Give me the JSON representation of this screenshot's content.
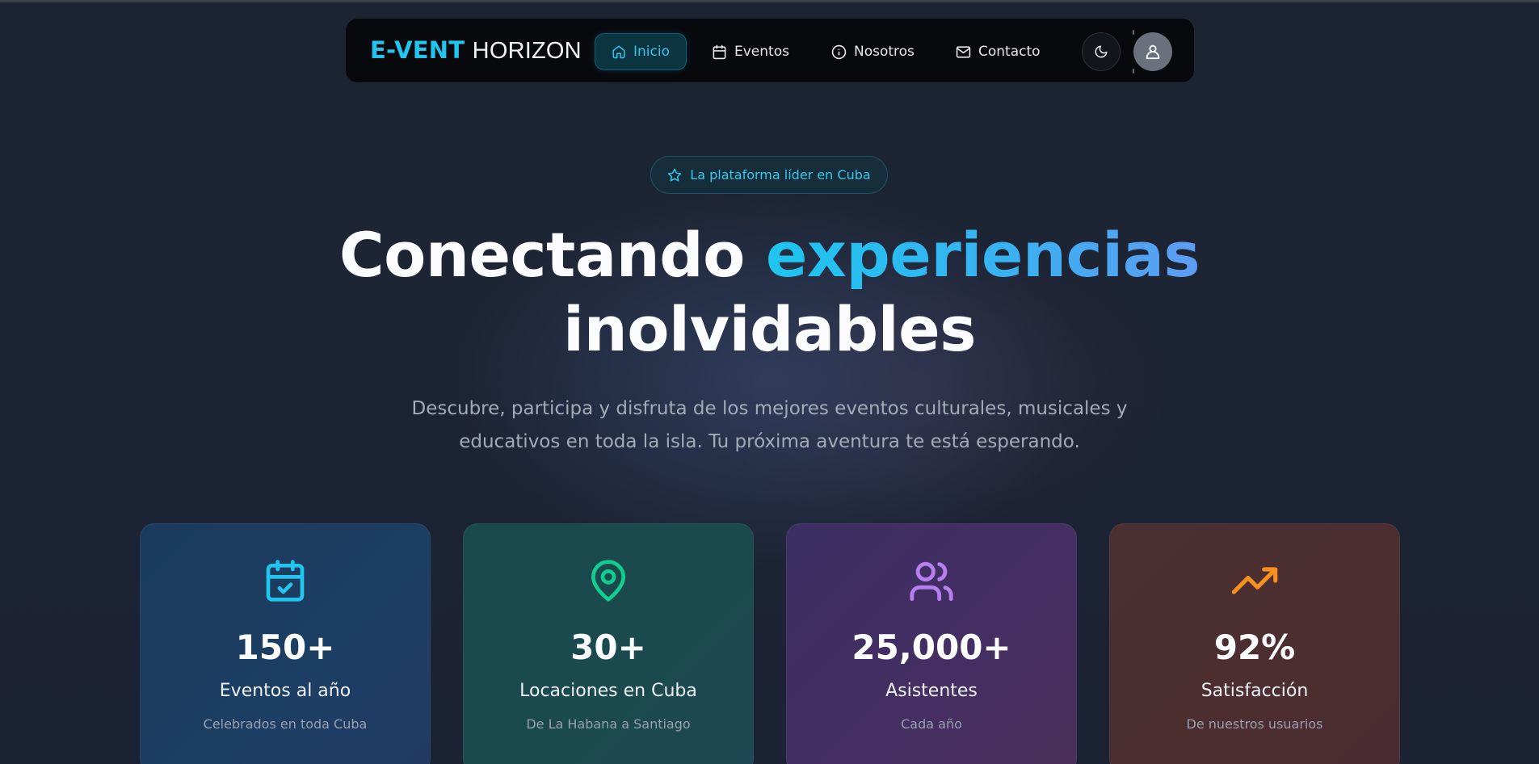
{
  "brand": {
    "part1": "E-VENT",
    "part2": "HORIZON"
  },
  "nav": {
    "items": [
      {
        "label": "Inicio",
        "icon": "home-icon",
        "active": true
      },
      {
        "label": "Eventos",
        "icon": "calendar-icon",
        "active": false
      },
      {
        "label": "Nosotros",
        "icon": "info-icon",
        "active": false
      },
      {
        "label": "Contacto",
        "icon": "mail-icon",
        "active": false
      }
    ],
    "theme_toggle_icon": "moon-icon",
    "user_icon": "user-icon"
  },
  "hero": {
    "badge": "La plataforma líder en Cuba",
    "badge_icon": "star-icon",
    "headline_part1": "Conectando ",
    "headline_highlight": "experiencias",
    "headline_part2": "inolvidables",
    "subtitle_line1": "Descubre, participa y disfruta de los mejores eventos culturales, musicales y",
    "subtitle_line2": "educativos en toda la isla. Tu próxima aventura te está esperando."
  },
  "stats": [
    {
      "value": "150+",
      "label": "Eventos al año",
      "description": "Celebrados en toda Cuba",
      "icon": "calendar-check-icon",
      "color": "#22c5ee"
    },
    {
      "value": "30+",
      "label": "Locaciones en Cuba",
      "description": "De La Habana a Santiago",
      "icon": "map-pin-icon",
      "color": "#10cf8e"
    },
    {
      "value": "25,000+",
      "label": "Asistentes",
      "description": "Cada año",
      "icon": "users-icon",
      "color": "#b77ef0"
    },
    {
      "value": "92%",
      "label": "Satisfacción",
      "description": "De nuestros usuarios",
      "icon": "trending-up-icon",
      "color": "#f7901e"
    }
  ],
  "colors": {
    "accent": "#22c5ee",
    "background": "#1c2332",
    "nav_background": "#07090d"
  }
}
